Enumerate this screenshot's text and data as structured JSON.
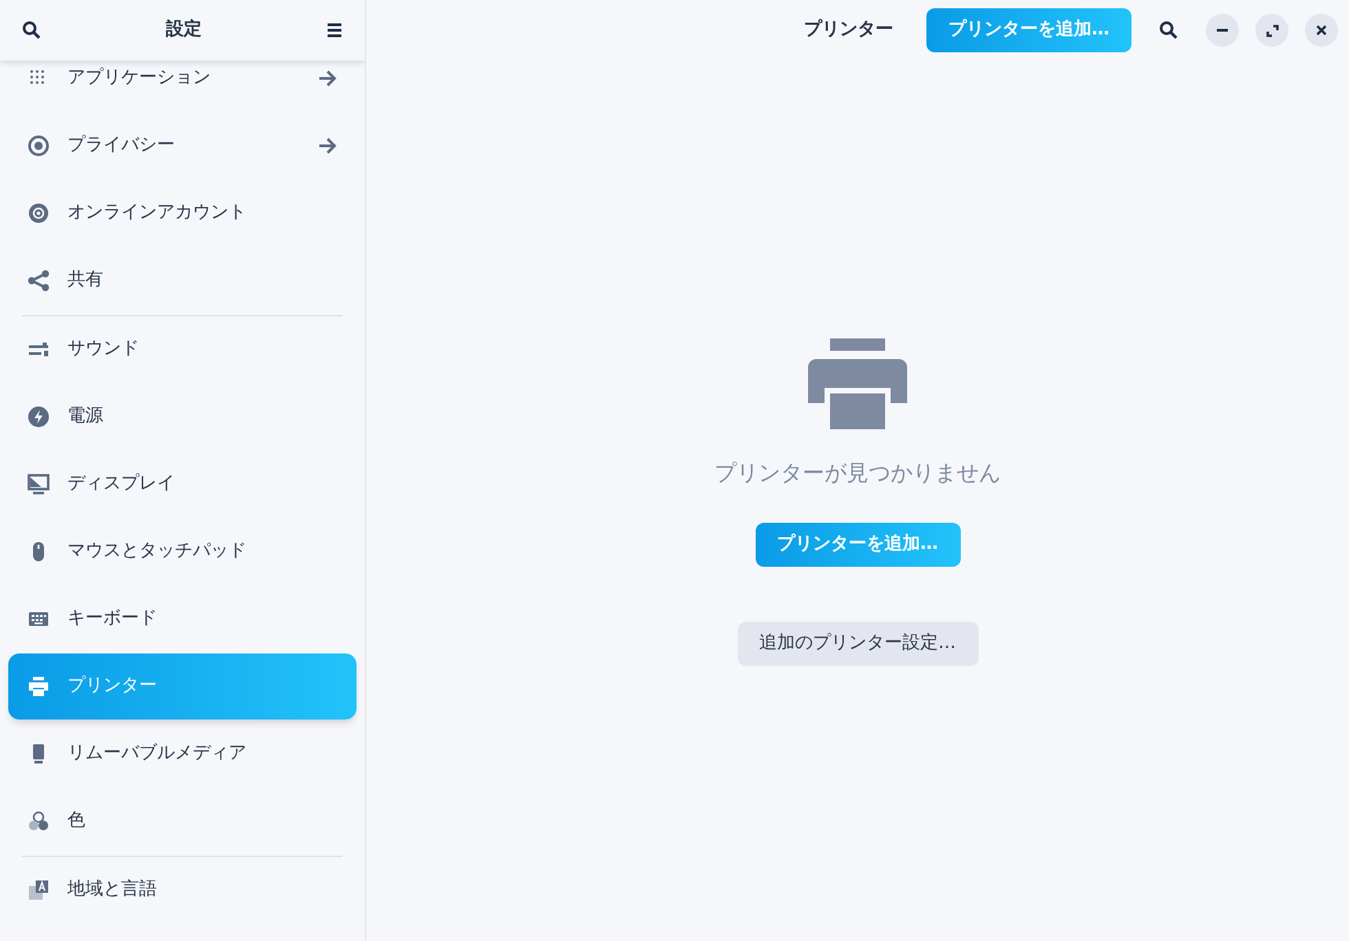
{
  "sidebar": {
    "title": "設定",
    "sections": [
      {
        "items": [
          {
            "label": "アプリケーション",
            "arrow": true,
            "selected": false
          },
          {
            "label": "プライバシー",
            "arrow": true,
            "selected": false
          },
          {
            "label": "オンラインアカウント",
            "arrow": false,
            "selected": false
          },
          {
            "label": "共有",
            "arrow": false,
            "selected": false
          }
        ]
      },
      {
        "items": [
          {
            "label": "サウンド",
            "arrow": false,
            "selected": false
          },
          {
            "label": "電源",
            "arrow": false,
            "selected": false
          },
          {
            "label": "ディスプレイ",
            "arrow": false,
            "selected": false
          },
          {
            "label": "マウスとタッチパッド",
            "arrow": false,
            "selected": false
          },
          {
            "label": "キーボード",
            "arrow": false,
            "selected": false
          },
          {
            "label": "プリンター",
            "arrow": false,
            "selected": true
          },
          {
            "label": "リムーバブルメディア",
            "arrow": false,
            "selected": false
          },
          {
            "label": "色",
            "arrow": false,
            "selected": false
          }
        ]
      },
      {
        "items": [
          {
            "label": "地域と言語",
            "arrow": false,
            "selected": false
          }
        ]
      }
    ]
  },
  "header": {
    "title": "プリンター",
    "add_button": "プリンターを追加…"
  },
  "empty_state": {
    "message": "プリンターが見つかりません",
    "add_button": "プリンターを追加…",
    "settings_button": "追加のプリンター設定…"
  }
}
